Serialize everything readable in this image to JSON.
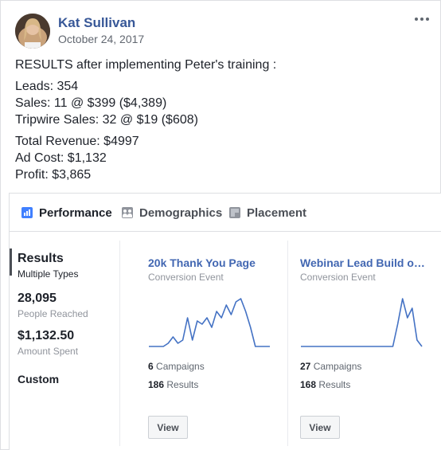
{
  "post": {
    "author": "Kat Sullivan",
    "date": "October 24, 2017",
    "lines": [
      "RESULTS after implementing Peter's training :",
      "",
      "Leads: 354",
      "Sales: 11 @ $399 ($4,389)",
      "Tripwire Sales: 32 @ $19 ($608)",
      "",
      "Total Revenue: $4997",
      "Ad Cost: $1,132",
      "Profit: $3,865"
    ]
  },
  "ads_summary": {
    "tabs": [
      {
        "label": "Performance",
        "icon": "bar-chart-icon"
      },
      {
        "label": "Demographics",
        "icon": "people-icon"
      },
      {
        "label": "Placement",
        "icon": "placement-icon"
      }
    ],
    "active_tab": "Performance",
    "results": {
      "title": "Results",
      "subtitle": "Multiple Types",
      "reach_value": "28,095",
      "reach_label": "People Reached",
      "spent_value": "$1,132.50",
      "spent_label": "Amount Spent",
      "custom_label": "Custom"
    },
    "cards": [
      {
        "title": "20k Thank You Page",
        "subtitle": "Conversion Event",
        "campaigns_value": "6",
        "campaigns_label": "Campaigns",
        "results_value": "186",
        "results_label": "Results",
        "view_label": "View",
        "trend": [
          0,
          0,
          0,
          0,
          1,
          3,
          1,
          2,
          9,
          2,
          8,
          7,
          9,
          6,
          11,
          9,
          13,
          10,
          14,
          15,
          11,
          6,
          0,
          0,
          0,
          0
        ]
      },
      {
        "title": "Webinar Lead Build on ...",
        "subtitle": "Conversion Event",
        "campaigns_value": "27",
        "campaigns_label": "Campaigns",
        "results_value": "168",
        "results_label": "Results",
        "view_label": "View",
        "trend": [
          0,
          0,
          0,
          0,
          0,
          0,
          0,
          0,
          0,
          0,
          0,
          0,
          0,
          0,
          0,
          0,
          0,
          0,
          0,
          0,
          7,
          15,
          9,
          12,
          2,
          0
        ]
      }
    ],
    "chart_color": "#4472c4"
  }
}
